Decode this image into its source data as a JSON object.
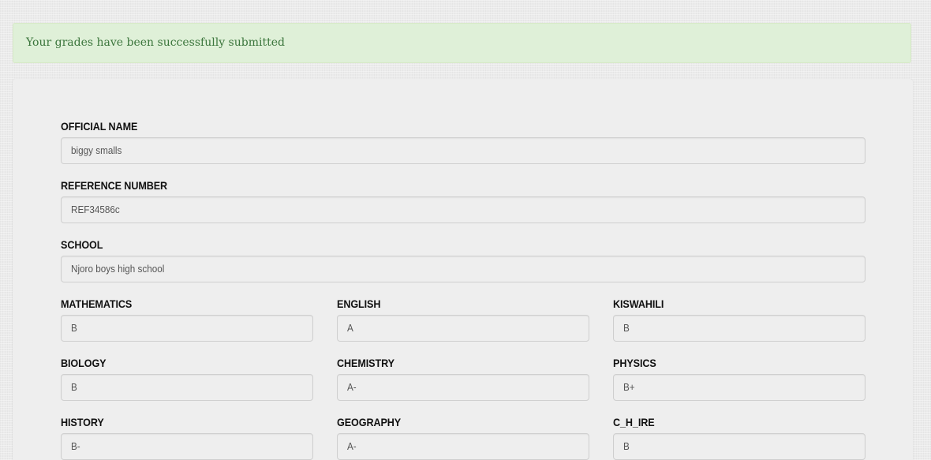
{
  "alert": {
    "message": "Your grades have been successfully submitted",
    "color": "#3c763d",
    "background": "#dff0d8"
  },
  "form": {
    "official_name": {
      "label": "OFFICIAL NAME",
      "value": "biggy smalls"
    },
    "reference_number": {
      "label": "REFERENCE NUMBER",
      "value": "REF34586c"
    },
    "school": {
      "label": "SCHOOL",
      "value": "Njoro boys high school"
    },
    "subjects": [
      {
        "label": "MATHEMATICS",
        "value": "B"
      },
      {
        "label": "ENGLISH",
        "value": "A"
      },
      {
        "label": "KISWAHILI",
        "value": "B"
      },
      {
        "label": "BIOLOGY",
        "value": "B"
      },
      {
        "label": "CHEMISTRY",
        "value": "A-"
      },
      {
        "label": "PHYSICS",
        "value": "B+"
      },
      {
        "label": "HISTORY",
        "value": "B-"
      },
      {
        "label": "GEOGRAPHY",
        "value": "A-"
      },
      {
        "label": "C_H_IRE",
        "value": "B"
      }
    ]
  }
}
